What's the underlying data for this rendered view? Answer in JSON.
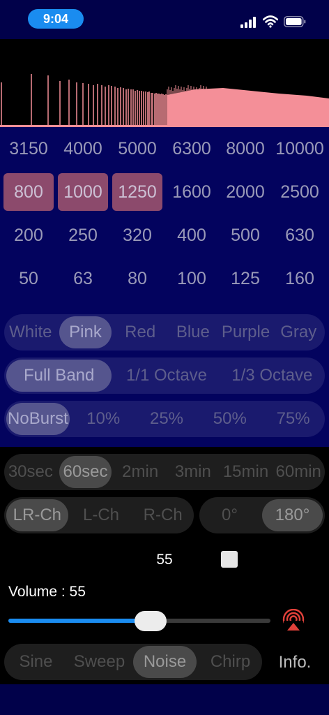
{
  "status": {
    "time": "9:04"
  },
  "frequencies": {
    "row1": [
      "3150",
      "4000",
      "5000",
      "6300",
      "8000",
      "10000"
    ],
    "row2": [
      "800",
      "1000",
      "1250",
      "1600",
      "2000",
      "2500"
    ],
    "row3": [
      "200",
      "250",
      "320",
      "400",
      "500",
      "630"
    ],
    "row4": [
      "50",
      "63",
      "80",
      "100",
      "125",
      "160"
    ],
    "selected": [
      "800",
      "1000",
      "1250"
    ]
  },
  "noise_color": {
    "options": [
      "White",
      "Pink",
      "Red",
      "Blue",
      "Purple",
      "Gray"
    ],
    "selected": "Pink"
  },
  "band": {
    "options": [
      "Full Band",
      "1/1 Octave",
      "1/3 Octave"
    ],
    "selected": "Full Band"
  },
  "burst": {
    "options": [
      "NoBurst",
      "10%",
      "25%",
      "50%",
      "75%"
    ],
    "selected": "NoBurst"
  },
  "duration": {
    "options": [
      "30sec",
      "60sec",
      "2min",
      "3min",
      "15min",
      "60min"
    ],
    "selected": "60sec"
  },
  "channel": {
    "options": [
      "LR-Ch",
      "L-Ch",
      "R-Ch"
    ],
    "selected": "LR-Ch"
  },
  "phase": {
    "options": [
      "0°",
      "180°"
    ],
    "selected": "180°"
  },
  "value_display": "55",
  "volume": {
    "label": "Volume : 55",
    "value": 55,
    "fraction": 0.55
  },
  "mode": {
    "options": [
      "Sine",
      "Sweep",
      "Noise",
      "Chirp"
    ],
    "selected": "Noise"
  },
  "info_label": "Info.",
  "colors": {
    "accent": "#1a8cf0",
    "spectrum": "#f48f98",
    "selected_freq": "#8c4a6c",
    "airplay": "#e2413a"
  }
}
